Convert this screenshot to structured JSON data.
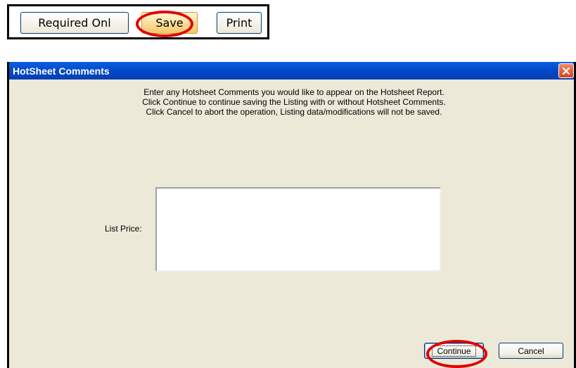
{
  "toolbar": {
    "required_label": "Required Onl",
    "save_label": "Save",
    "print_label": "Print"
  },
  "dialog": {
    "title": "HotSheet Comments",
    "close_icon": "close-icon",
    "instructions": [
      "Enter any Hotsheet Comments you would like to appear on the Hotsheet Report.",
      "Click Continue to continue saving the Listing with or without Hotsheet Comments.",
      "Click Cancel to abort the operation, Listing data/modifications will not be saved."
    ],
    "field_label": "List Price:",
    "comments_value": "",
    "continue_label": "Continue",
    "cancel_label": "Cancel"
  },
  "colors": {
    "highlight": "#e00000",
    "titlebar": "#0a5fe0",
    "dialog_bg": "#ece9d8",
    "close_button": "#d8401c"
  }
}
